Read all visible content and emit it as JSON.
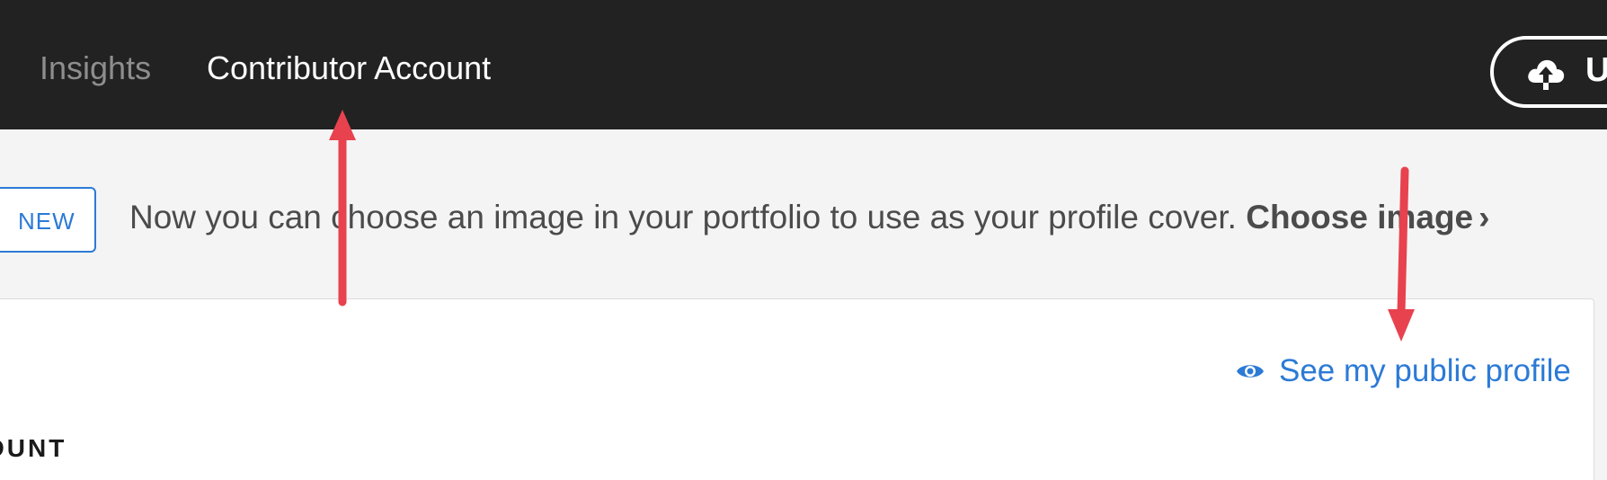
{
  "nav": {
    "insights_label": "Insights",
    "contributor_label": "Contributor Account"
  },
  "upload": {
    "label": "U",
    "icon": "cloud-upload-icon"
  },
  "banner": {
    "badge": "NEW",
    "message": "Now you can choose an image in your portfolio to use as your profile cover.",
    "cta": "Choose image",
    "cta_icon": "chevron-right-icon"
  },
  "card": {
    "public_profile_label": "See my public profile",
    "public_profile_icon": "eye-icon",
    "section_heading": "OUNT"
  },
  "colors": {
    "topbar": "#222222",
    "accent_blue": "#2c7ad6",
    "annotation_red": "#e8424f",
    "banner_bg": "#f4f4f4"
  }
}
